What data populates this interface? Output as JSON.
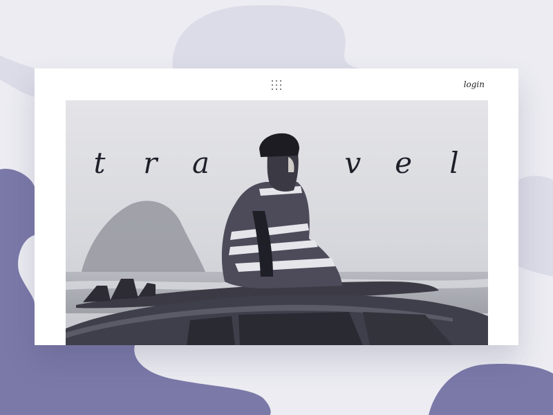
{
  "header": {
    "menu_icon": "grid-menu-icon",
    "login_label": "login"
  },
  "hero": {
    "title_letters": [
      "t",
      "r",
      "a",
      "",
      "",
      "v",
      "e",
      "l"
    ]
  },
  "colors": {
    "background": "#ececf2",
    "accent_shape": "#7b79a8",
    "card": "#ffffff",
    "text": "#1f1f2a"
  }
}
